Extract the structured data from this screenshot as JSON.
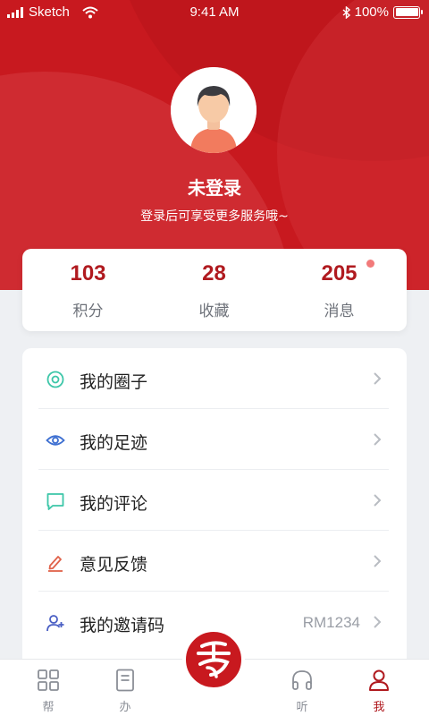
{
  "status_bar": {
    "carrier": "Sketch",
    "time": "9:41 AM",
    "battery": "100%"
  },
  "profile": {
    "name": "未登录",
    "hint": "登录后可享受更多服务哦~"
  },
  "stats": [
    {
      "value": "103",
      "label": "积分"
    },
    {
      "value": "28",
      "label": "收藏"
    },
    {
      "value": "205",
      "label": "消息"
    }
  ],
  "menu": [
    {
      "label": "我的圈子",
      "icon": "circle-target-icon",
      "value": ""
    },
    {
      "label": "我的足迹",
      "icon": "eye-icon",
      "value": ""
    },
    {
      "label": "我的评论",
      "icon": "comment-icon",
      "value": ""
    },
    {
      "label": "意见反馈",
      "icon": "edit-icon",
      "value": ""
    },
    {
      "label": "我的邀请码",
      "icon": "add-user-icon",
      "value": "RM1234"
    }
  ],
  "tabs": [
    {
      "label": "帮",
      "icon": "grid-icon"
    },
    {
      "label": "办",
      "icon": "document-icon"
    },
    {
      "label": "",
      "icon": "brand-logo"
    },
    {
      "label": "听",
      "icon": "headphones-icon"
    },
    {
      "label": "我",
      "icon": "user-icon",
      "active": true
    }
  ],
  "colors": {
    "brand": "#c8191f",
    "stat_number": "#b01a1f",
    "badge_dot": "#f27a7a"
  }
}
